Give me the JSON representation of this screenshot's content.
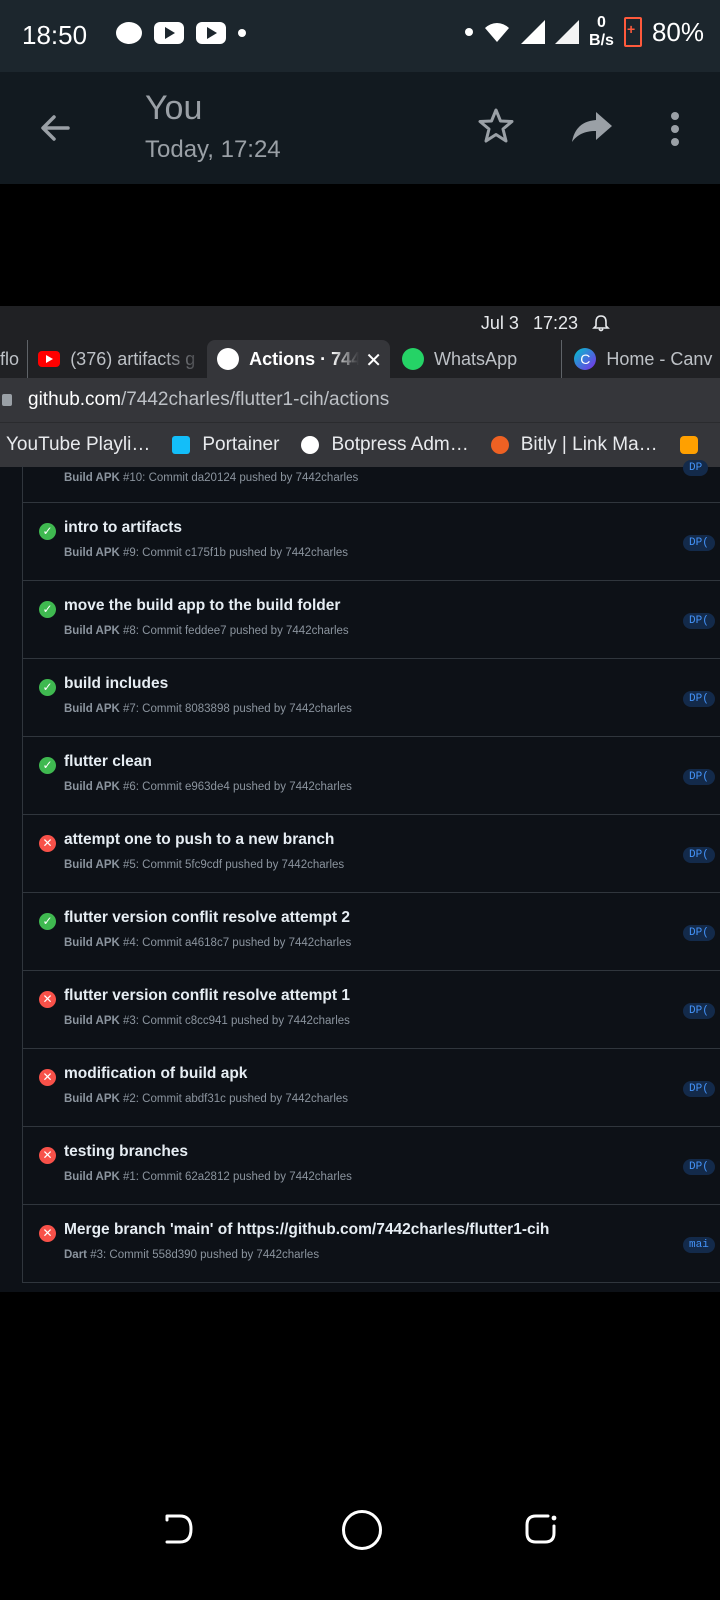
{
  "status_bar": {
    "time": "18:50",
    "net_speed_value": "0",
    "net_speed_unit": "B/s",
    "battery": "80%"
  },
  "header": {
    "title": "You",
    "subtitle": "Today, 17:24"
  },
  "screenshot": {
    "date": "Jul 3",
    "time": "17:23",
    "tabs": [
      {
        "label": "flo",
        "icon": "generic"
      },
      {
        "label": "(376) artifacts g",
        "icon": "youtube-icon"
      },
      {
        "label": "Actions · 744",
        "icon": "github-icon",
        "active": true
      },
      {
        "label": "WhatsApp",
        "icon": "whatsapp-icon"
      },
      {
        "label": "Home - Canv",
        "icon": "canva-icon"
      }
    ],
    "url_host": "github.com",
    "url_path": "/7442charles/flutter1-cih/actions",
    "bookmarks": [
      {
        "label": "YouTube Playli…",
        "icon": "youtube-icon"
      },
      {
        "label": "Portainer",
        "icon": "portainer-icon",
        "color": "#13bef9"
      },
      {
        "label": "Botpress Adm…",
        "icon": "botpress-icon",
        "color": "#ffffff"
      },
      {
        "label": "Bitly | Link Ma…",
        "icon": "bitly-icon",
        "color": "#ee6123"
      }
    ],
    "runs": [
      {
        "title": "",
        "workflow": "Build APK",
        "meta": " #10: Commit da20124 pushed by 7442charles",
        "status": "none",
        "badge": "DP"
      },
      {
        "title": "intro to artifacts",
        "workflow": "Build APK",
        "meta": " #9: Commit c175f1b pushed by 7442charles",
        "status": "success",
        "badge": "DP("
      },
      {
        "title": "move the build app to the build folder",
        "workflow": "Build APK",
        "meta": " #8: Commit feddee7 pushed by 7442charles",
        "status": "success",
        "badge": "DP("
      },
      {
        "title": "build includes",
        "workflow": "Build APK",
        "meta": " #7: Commit 8083898 pushed by 7442charles",
        "status": "success",
        "badge": "DP("
      },
      {
        "title": "flutter clean",
        "workflow": "Build APK",
        "meta": " #6: Commit e963de4 pushed by 7442charles",
        "status": "success",
        "badge": "DP("
      },
      {
        "title": "attempt one to push to a new branch",
        "workflow": "Build APK",
        "meta": " #5: Commit 5fc9cdf pushed by 7442charles",
        "status": "failure",
        "badge": "DP("
      },
      {
        "title": "flutter version conflit resolve attempt 2",
        "workflow": "Build APK",
        "meta": " #4: Commit a4618c7 pushed by 7442charles",
        "status": "success",
        "badge": "DP("
      },
      {
        "title": "flutter version conflit resolve attempt 1",
        "workflow": "Build APK",
        "meta": " #3: Commit c8cc941 pushed by 7442charles",
        "status": "failure",
        "badge": "DP("
      },
      {
        "title": "modification of build apk",
        "workflow": "Build APK",
        "meta": " #2: Commit abdf31c pushed by 7442charles",
        "status": "failure",
        "badge": "DP("
      },
      {
        "title": "testing branches",
        "workflow": "Build APK",
        "meta": " #1: Commit 62a2812 pushed by 7442charles",
        "status": "failure",
        "badge": "DP("
      },
      {
        "title": "Merge branch 'main' of https://github.com/7442charles/flutter1-cih",
        "workflow": "Dart",
        "meta": " #3: Commit 558d390 pushed by 7442charles",
        "status": "failure",
        "badge": "mai"
      }
    ]
  },
  "colors": {
    "success": "#3fb950",
    "failure": "#f85149"
  }
}
